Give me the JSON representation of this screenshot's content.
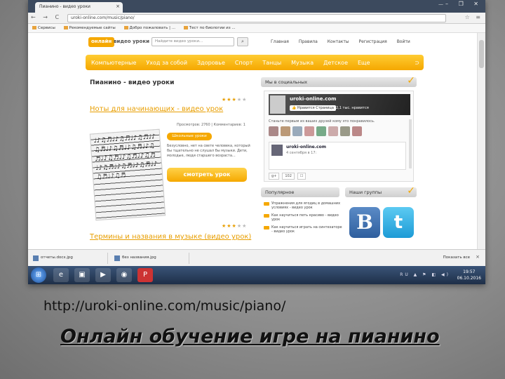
{
  "browser": {
    "tab_title": "Пианино - видео уроки",
    "tab_close": "×",
    "user_chip": "—",
    "window_controls": "– ❐ ✕",
    "nav_buttons": "← → C",
    "url": "uroki-online.com/music/piano/",
    "addr_right": "☆ ≡",
    "bookmarks": [
      "Сервисы",
      "Рекомендуемые сайты",
      "Добро пожаловать | ...",
      "Тест по биологии из ..."
    ]
  },
  "site": {
    "logo": "онлайн",
    "logo_sub": "видео уроки",
    "search_placeholder": "Найдите видео уроки...",
    "search_icon": "⌕",
    "top_nav": [
      "Главная",
      "Правила",
      "Контакты",
      "Регистрация",
      "Войти"
    ],
    "menu": [
      "Компьютерные",
      "Уход за собой",
      "Здоровье",
      "Спорт",
      "Танцы",
      "Музыка",
      "Детское",
      "Еще"
    ],
    "rss": "⊃",
    "page_title": "Пианино - видео уроки"
  },
  "lesson1": {
    "stars_on": "★★★",
    "stars_off": "★★",
    "title": "Ноты для начинающих - видео урок",
    "meta": "Просмотров: 2760 | Комментариев: 1",
    "tag": "Школьные уроки",
    "desc": "Безусловно, нет на свете человека, который бы тщательно не слушал бы музыки. Дети, молодые, люди старшего возраста...",
    "watch": "смотреть урок",
    "sheet_notes": "♩♪♫♬♩♪♫♬♩♪♫♬♩♪♫♬♩♪♫♬♩♪♫♬♩♪♫♬♩♪♫♬♩♪♫♬♩♪♫♬♩♪♫♬♩♪♫♬♩♪♫♬♩♪♫♬♩♪♫♬"
  },
  "lesson2": {
    "stars_on": "★★★",
    "stars_off": "★★",
    "title": "Термины и названия в музыке (видео урок)"
  },
  "sidebar": {
    "social_head": "Мы в социальных",
    "fb_name": "uroki-online.com",
    "fb_like": "👍 Нравится Страница",
    "fb_count": "2,1 тыс. нравится",
    "fb_friends": "Станьте первым из ваших друзей кому это понравилось.",
    "post_name": "uroki-online.com",
    "post_date": "4 сентября в 17:",
    "share": [
      "g+",
      "102",
      "☐"
    ],
    "popular_head": "Популярное",
    "groups_head": "Наши группы",
    "popular_items": [
      "Упражнения для ягодиц в домашних условиях - видео урок",
      "Как научиться петь красиво - видео урок",
      "Как научиться играть на синтезаторе - видео урок"
    ],
    "vk_letter": "B",
    "tw_letter": "t",
    "check": "✓"
  },
  "downloads": {
    "items": [
      "отчеты.docx.jpg",
      "без названия.jpg"
    ],
    "show_all": "Показать все",
    "close": "×"
  },
  "taskbar": {
    "start": "⊞",
    "apps": [
      "e",
      "▣",
      "▶",
      "◉",
      "P"
    ],
    "tray": "RU ▲ ⚑ ◧ ◀)",
    "time": "19:57",
    "date": "06.10.2016"
  },
  "slide": {
    "caption_url": "http://uroki-online.com/music/piano/",
    "title": "Онлайн обучение игре на пианино"
  }
}
